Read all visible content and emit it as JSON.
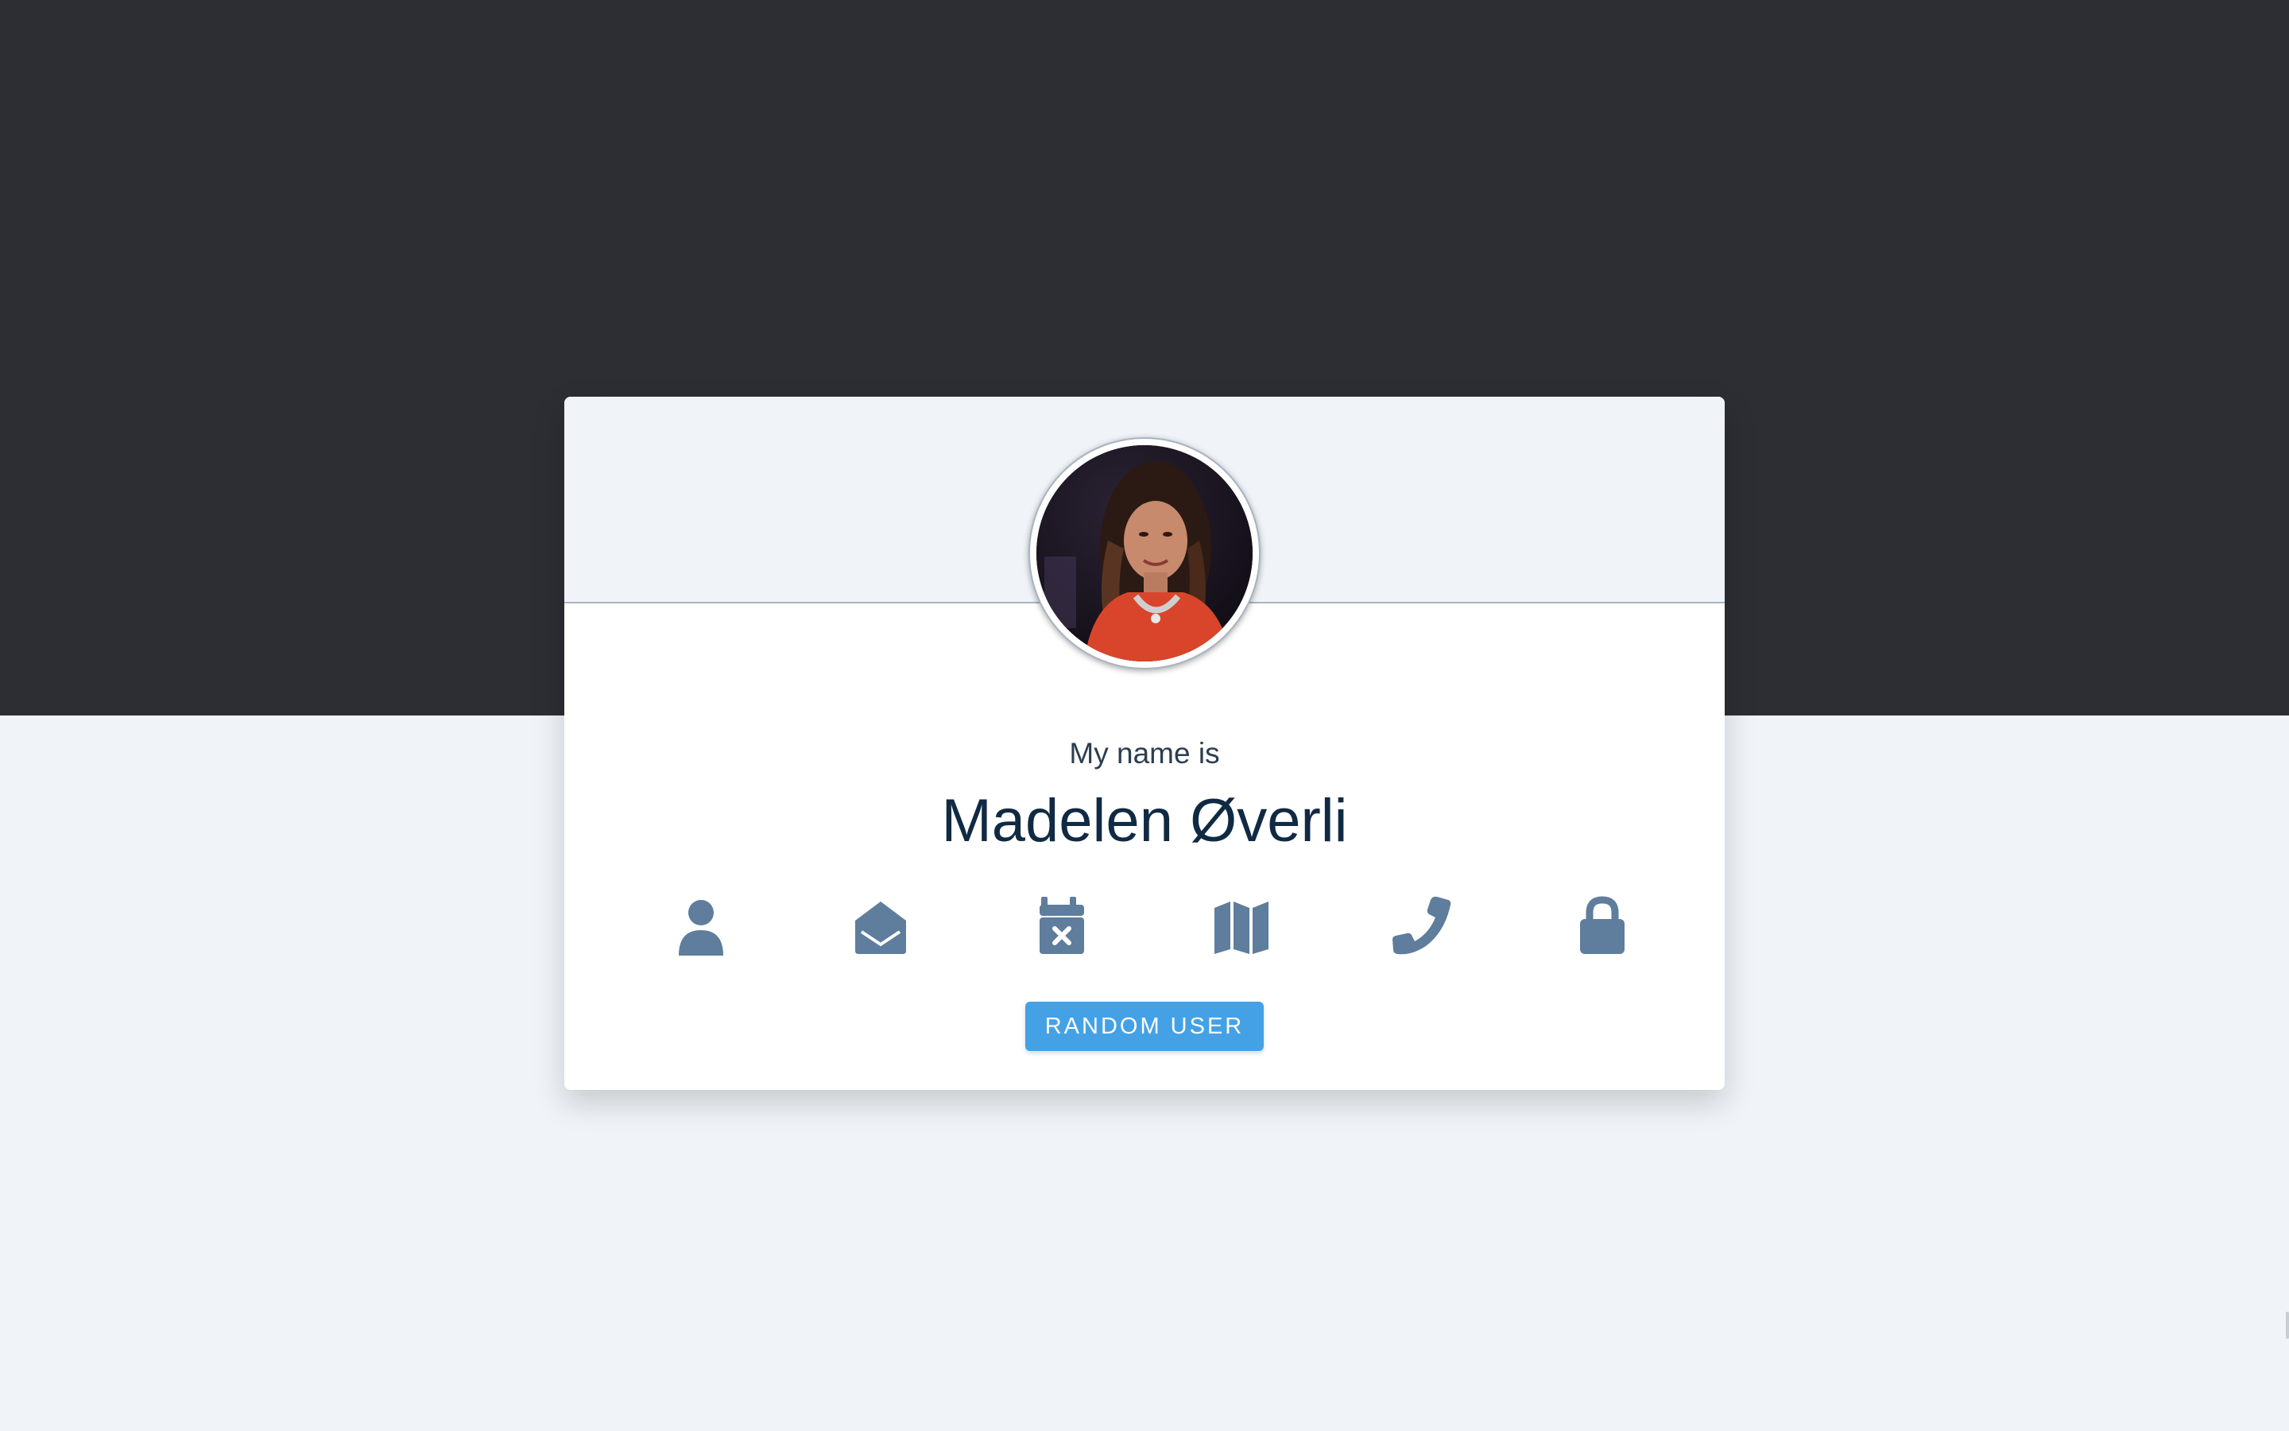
{
  "header": {
    "avatar_alt": "user avatar"
  },
  "profile": {
    "caption": "My name is",
    "value": "Madelen Øverli"
  },
  "icons": [
    {
      "name": "user-icon"
    },
    {
      "name": "envelope-open-icon"
    },
    {
      "name": "calendar-x-icon"
    },
    {
      "name": "map-icon"
    },
    {
      "name": "phone-icon"
    },
    {
      "name": "lock-icon"
    }
  ],
  "actions": {
    "random_user_label": "RANDOM USER"
  },
  "colors": {
    "dark_band": "#2d2e33",
    "page_bg": "#f0f4f8",
    "icon": "#5f7d9c",
    "button": "#44a1e6",
    "name_text": "#102a43"
  }
}
